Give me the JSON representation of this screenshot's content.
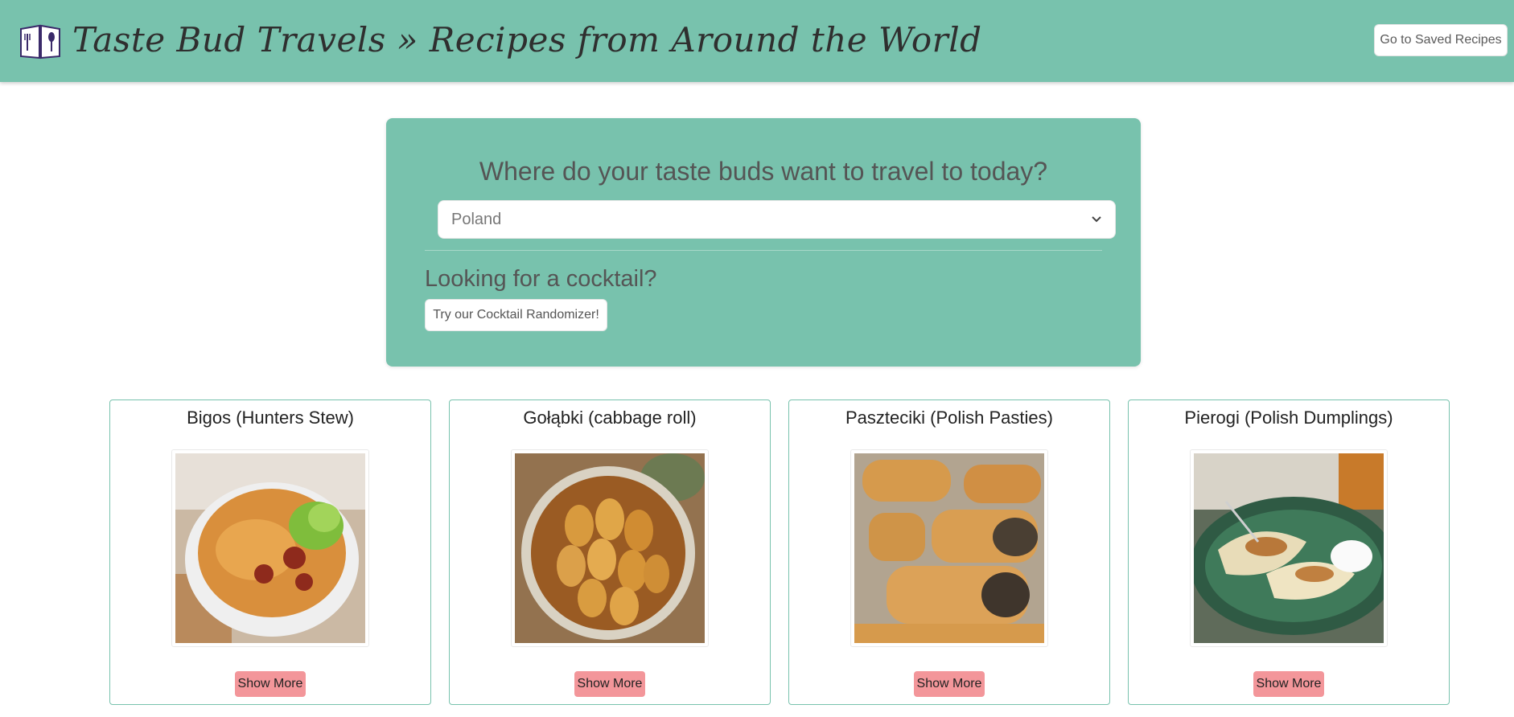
{
  "header": {
    "title": "Taste Bud Travels » Recipes from Around the World",
    "saved_button": "Go to Saved Recipes",
    "logo_icon": "recipe-book-icon",
    "background": "#78c2ad"
  },
  "search_panel": {
    "question": "Where do your taste buds want to travel to today?",
    "country_select": {
      "selected": "Poland",
      "icon": "chevron-down-icon"
    },
    "cocktail_heading": "Looking for a cocktail?",
    "cocktail_button": "Try our Cocktail Randomizer!"
  },
  "recipes": [
    {
      "title": "Bigos (Hunters Stew)",
      "button": "Show More",
      "image": "bigos-photo"
    },
    {
      "title": "Gołąbki (cabbage roll)",
      "button": "Show More",
      "image": "golabki-photo"
    },
    {
      "title": "Paszteciki (Polish Pasties)",
      "button": "Show More",
      "image": "paszteciki-photo"
    },
    {
      "title": "Pierogi (Polish Dumplings)",
      "button": "Show More",
      "image": "pierogi-photo"
    }
  ],
  "colors": {
    "accent": "#78c2ad",
    "button_pink": "#f3969a"
  }
}
